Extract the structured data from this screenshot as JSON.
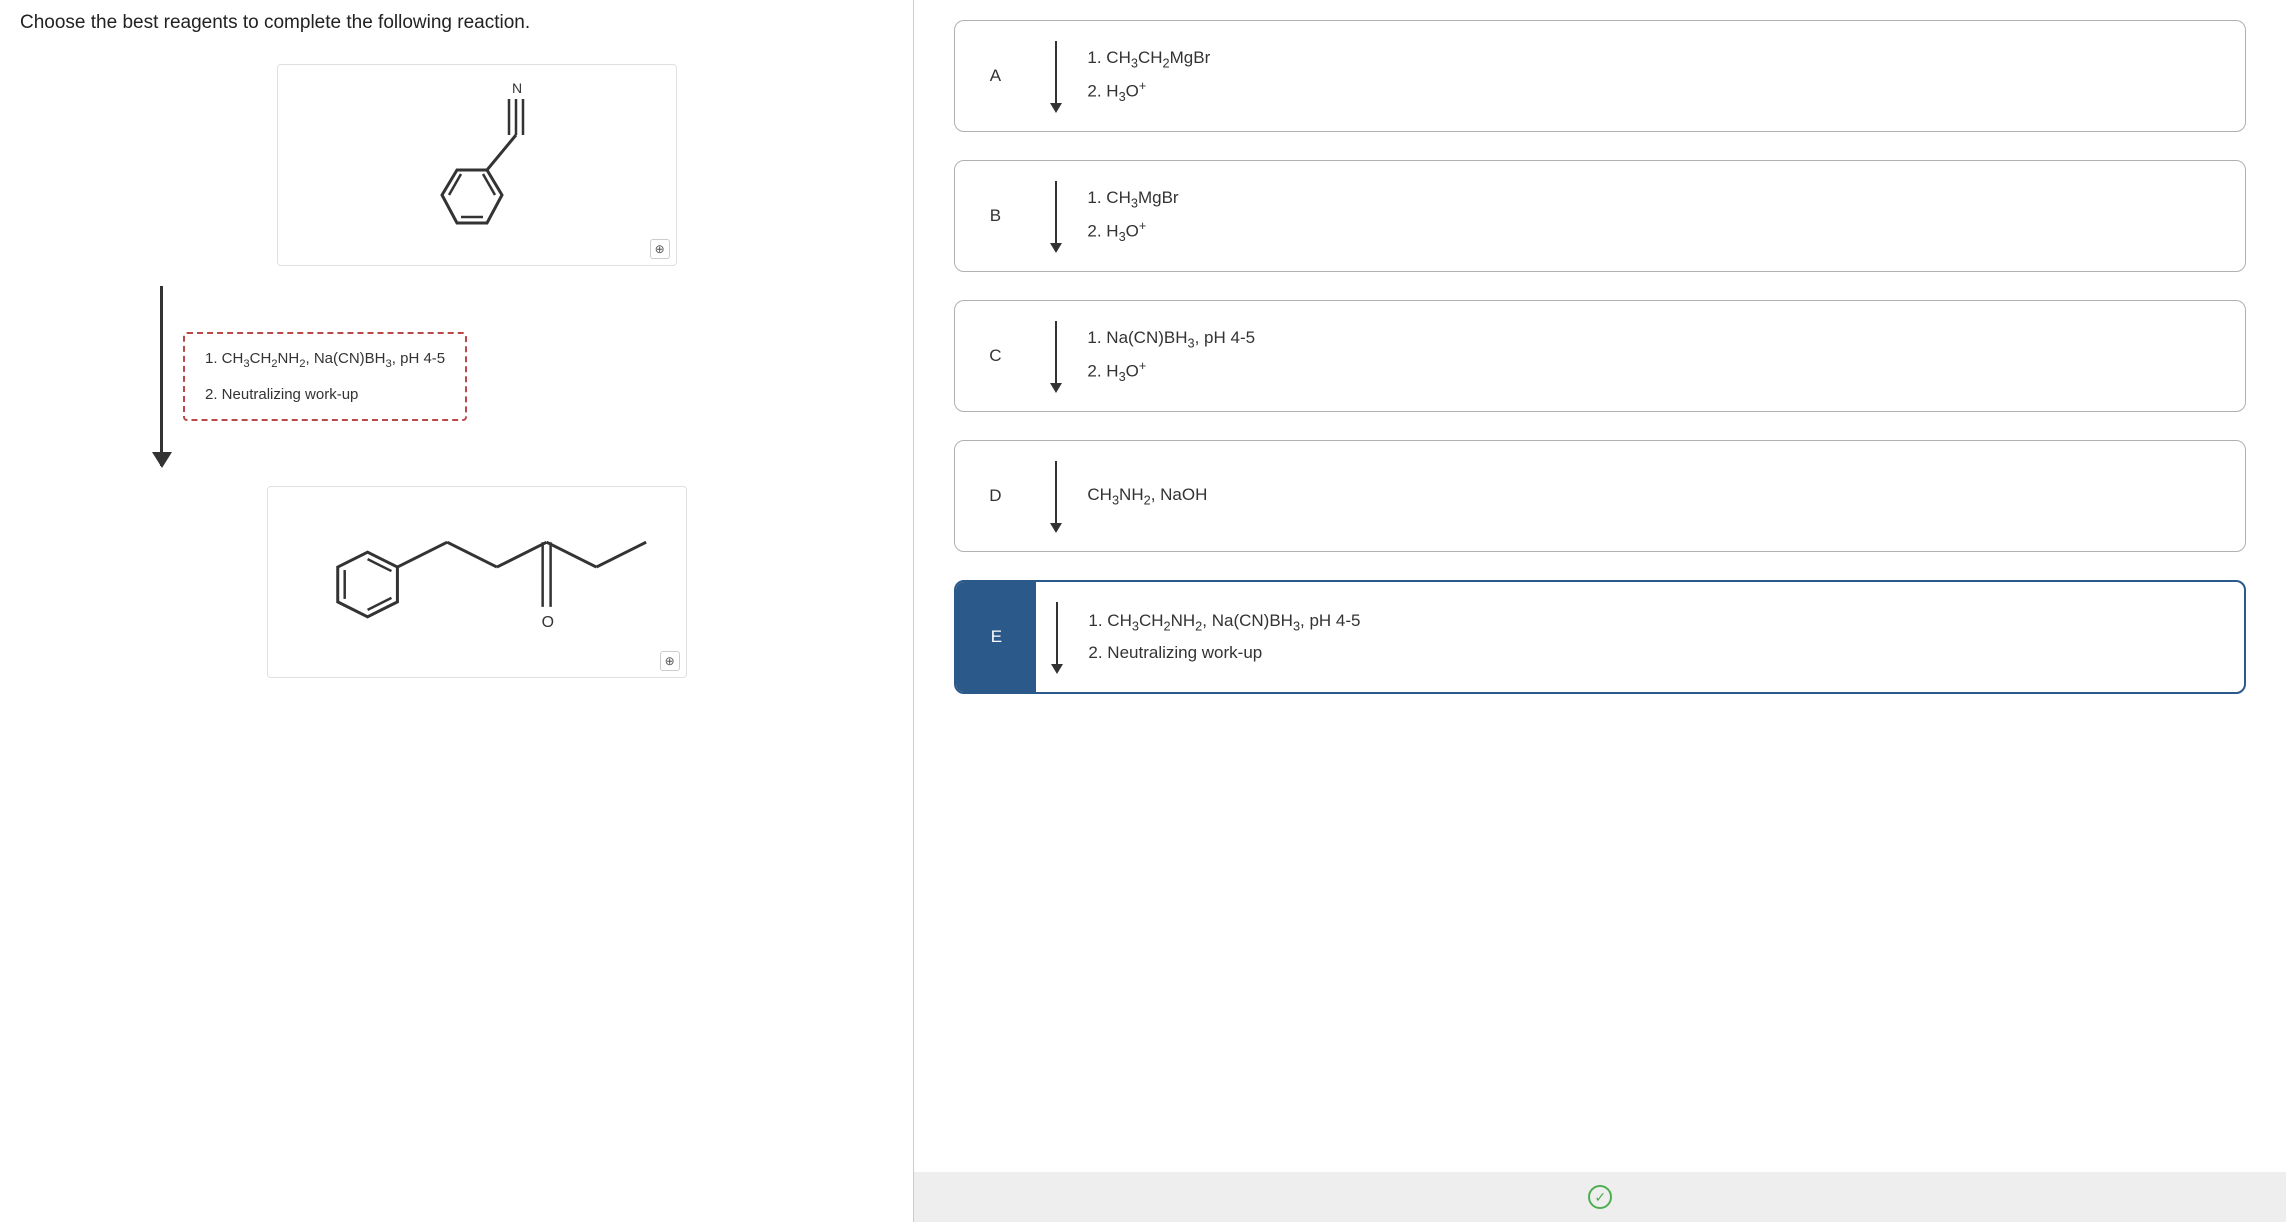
{
  "question": "Choose the best reagents to complete the following reaction.",
  "molecule1_label": "N",
  "molecule2_label": "O",
  "reagent_selected": {
    "line1": "1. CH₃CH₂NH₂, Na(CN)BH₃, pH 4-5",
    "line2": "2. Neutralizing work-up"
  },
  "options": [
    {
      "label": "A",
      "line1": "1. CH₃CH₂MgBr",
      "line2": "2. H₃O⁺",
      "selected": false
    },
    {
      "label": "B",
      "line1": "1. CH₃MgBr",
      "line2": "2. H₃O⁺",
      "selected": false
    },
    {
      "label": "C",
      "line1": "1. Na(CN)BH₃, pH 4-5",
      "line2": "2. H₃O⁺",
      "selected": false
    },
    {
      "label": "D",
      "line1": "CH₃NH₂, NaOH",
      "line2": "",
      "selected": false
    },
    {
      "label": "E",
      "line1": "1. CH₃CH₂NH₂, Na(CN)BH₃, pH 4-5",
      "line2": "2. Neutralizing work-up",
      "selected": true
    }
  ]
}
